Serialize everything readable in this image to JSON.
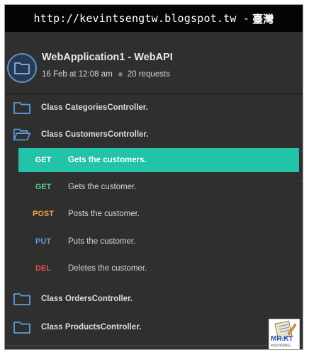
{
  "watermark": {
    "url": "http://kevintsengtw.blogspot.tw -",
    "place": "臺灣"
  },
  "collection": {
    "title": "WebApplication1 - WebAPI",
    "date": "16 Feb at 12:08 am",
    "requests": "20 requests",
    "icon": "folder-icon"
  },
  "folders": [
    {
      "label": "Class CategoriesController.",
      "icon": "folder-icon"
    },
    {
      "label": "Class CustomersController.",
      "icon": "folder-open-icon"
    },
    {
      "label": "Class OrdersController.",
      "icon": "folder-icon"
    },
    {
      "label": "Class ProductsController.",
      "icon": "folder-icon"
    }
  ],
  "requests": [
    {
      "method": "GET",
      "label": "Gets the customers.",
      "color": "#ffffff",
      "active": true
    },
    {
      "method": "GET",
      "label": "Gets the customer.",
      "color": "#55c98a",
      "active": false
    },
    {
      "method": "POST",
      "label": "Posts the customer.",
      "color": "#f0a33a",
      "active": false
    },
    {
      "method": "PUT",
      "label": "Puts the customer.",
      "color": "#5d9de0",
      "active": false
    },
    {
      "method": "DEL",
      "label": "Deletes the customer.",
      "color": "#e5534b",
      "active": false
    }
  ],
  "logo": {
    "brand": "MR.KT",
    "tagline": "的程式學習筆記"
  },
  "colors": {
    "accent": "#22c3a6",
    "folder": "#5d9de0",
    "background": "#2f2f2f"
  }
}
